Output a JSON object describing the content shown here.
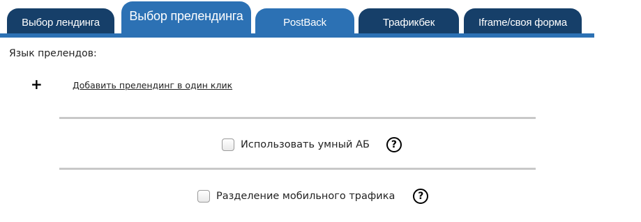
{
  "tabs": [
    {
      "label": "Выбор лендинга",
      "active": false
    },
    {
      "label": "Выбор прелендинга",
      "active": true
    },
    {
      "label": "PostBack",
      "active": false
    },
    {
      "label": "Трафикбек",
      "active": false
    },
    {
      "label": "Iframe/своя форма",
      "active": false
    }
  ],
  "content": {
    "language_label": "Язык прелендов:",
    "add_link": "Добавить прелендинг в один клик",
    "add_icon": "plus-icon",
    "options": [
      {
        "label": "Использовать умный АБ",
        "checked": false,
        "help_icon": "question-circle-icon",
        "help_glyph": "?"
      },
      {
        "label": "Разделение мобильного трафика",
        "checked": false,
        "help_icon": "question-circle-icon",
        "help_glyph": "?"
      }
    ]
  },
  "colors": {
    "tab_dark": "#163f69",
    "tab_blue": "#2c71b4",
    "divider": "#c8c8c8",
    "text": "#222222"
  }
}
